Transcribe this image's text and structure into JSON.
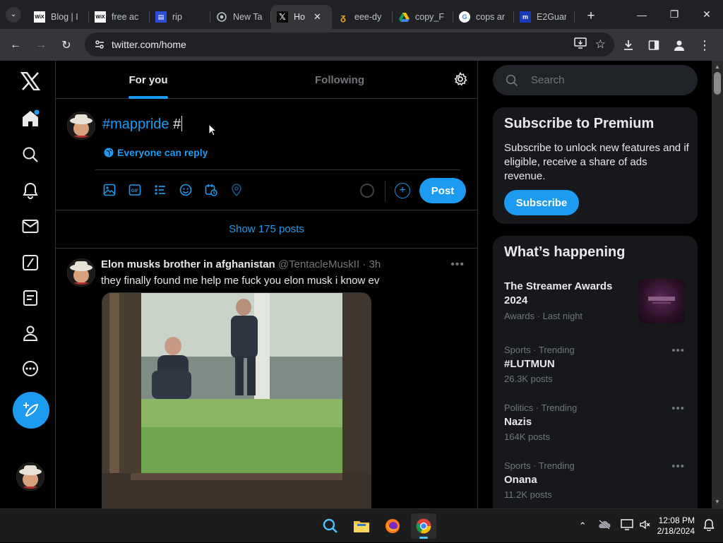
{
  "browser": {
    "tabs": [
      {
        "title": "Blog | I",
        "favicon": "wix-icon"
      },
      {
        "title": "free ac",
        "favicon": "wix-icon"
      },
      {
        "title": "rip",
        "favicon": "doc-icon"
      },
      {
        "title": "New Ta",
        "favicon": "chrome-icon"
      },
      {
        "title": "Ho",
        "favicon": "x-icon",
        "active": true
      },
      {
        "title": "eee-dy",
        "favicon": "fire-icon"
      },
      {
        "title": "copy_F",
        "favicon": "drive-icon"
      },
      {
        "title": "cops ar",
        "favicon": "google-icon"
      },
      {
        "title": "E2Guar",
        "favicon": "m-icon"
      }
    ],
    "url": "twitter.com/home"
  },
  "timeline": {
    "tabs": [
      "For you",
      "Following"
    ],
    "composer": {
      "hashtag": "#mappride",
      "typed": " #",
      "reply_setting": "Everyone can reply",
      "post_label": "Post"
    },
    "show_posts": "Show 175 posts",
    "tweet": {
      "name": "Elon musks brother in afghanistan",
      "handle": "@TentacleMuskII · 3h",
      "text": "they finally found me help me fuck you elon musk i know ev"
    }
  },
  "sidebar": {
    "search_placeholder": "Search",
    "premium": {
      "title": "Subscribe to Premium",
      "body": "Subscribe to unlock new features and if eligible, receive a share of ads revenue.",
      "button": "Subscribe"
    },
    "happening": {
      "title": "What’s happening",
      "trends": [
        {
          "context": "",
          "name": "The Streamer Awards 2024",
          "count": "Awards · Last night"
        },
        {
          "context": "Sports · Trending",
          "name": "#LUTMUN",
          "count": "26.3K posts"
        },
        {
          "context": "Politics · Trending",
          "name": "Nazis",
          "count": "164K posts"
        },
        {
          "context": "Sports · Trending",
          "name": "Onana",
          "count": "11.2K posts"
        }
      ]
    }
  },
  "taskbar": {
    "time": "12:08 PM",
    "date": "2/18/2024"
  },
  "colors": {
    "accent": "#1d9bf0",
    "background": "#000000",
    "card": "#16181c"
  }
}
